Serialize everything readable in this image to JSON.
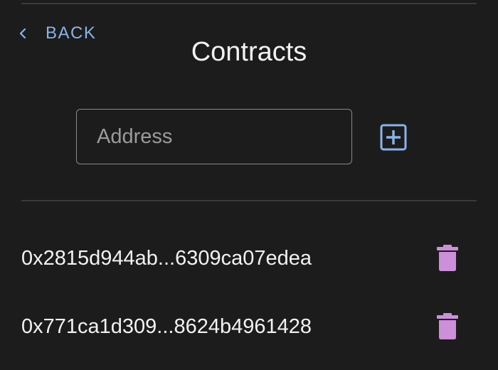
{
  "nav": {
    "back_label": "BACK"
  },
  "header": {
    "title": "Contracts"
  },
  "form": {
    "address_placeholder": "Address",
    "address_value": ""
  },
  "contracts": [
    {
      "address": "0x2815d944ab...6309ca07edea"
    },
    {
      "address": "0x771ca1d309...8624b4961428"
    }
  ],
  "icons": {
    "back": "chevron-left-icon",
    "add": "plus-square-icon",
    "delete": "trash-icon"
  },
  "colors": {
    "background": "#1c1c1d",
    "accent_blue": "#8ab4e8",
    "delete_purple": "#cc8fd9",
    "text": "#f2f2f2"
  }
}
